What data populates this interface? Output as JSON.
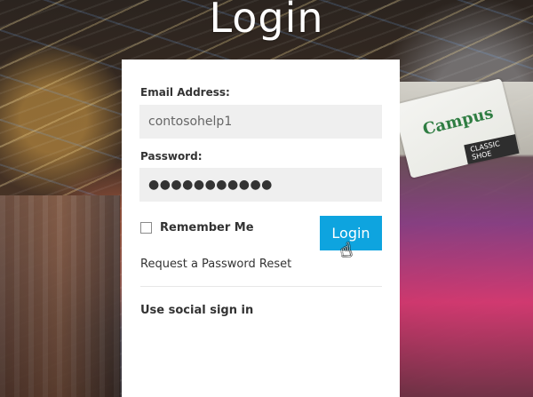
{
  "page": {
    "title": "Login"
  },
  "login_form": {
    "email_label": "Email Address:",
    "email_value": "contosohelp1",
    "password_label": "Password:",
    "password_value": "●●●●●●●●●●●",
    "remember_label": "Remember Me",
    "login_button_label": "Login",
    "reset_link_label": "Request a Password Reset",
    "social_sign_in_label": "Use social sign in"
  },
  "background": {
    "shop_sign_text": "Campus",
    "shop_sign_subtext": "CLASSIC SHOE"
  },
  "colors": {
    "accent": "#0ea4df",
    "panel_bg": "#ffffff",
    "input_bg": "#efefef",
    "text_main": "#333333"
  },
  "icons": {
    "cursor": "hand-pointer-icon"
  }
}
